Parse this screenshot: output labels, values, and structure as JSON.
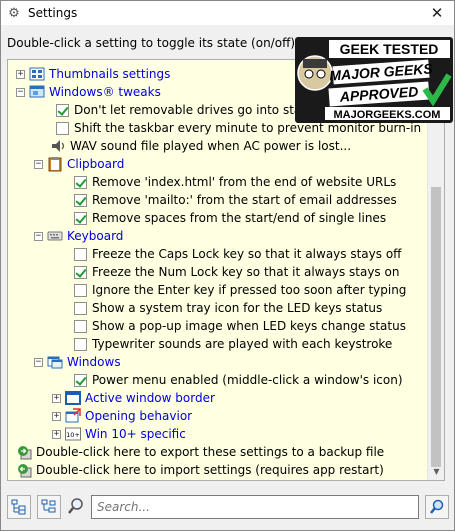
{
  "window": {
    "title": "Settings",
    "close_glyph": "✕"
  },
  "instruction": "Double-click a setting to toggle its state (on/off), or to alter its current value.",
  "tree": {
    "rows": [
      {
        "indent": 8,
        "expander": "+",
        "icon": "thumbnails-icon",
        "label": "Thumbnails settings",
        "blue": true
      },
      {
        "indent": 8,
        "expander": "−",
        "icon": "windows-tweaks-icon",
        "label": "Windows® tweaks",
        "blue": true
      },
      {
        "indent": 48,
        "check": true,
        "checked": true,
        "label": "Don't let removable drives go into standby"
      },
      {
        "indent": 48,
        "check": true,
        "checked": false,
        "label": "Shift the taskbar every minute to prevent monitor burn-in"
      },
      {
        "indent": 42,
        "icon": "speaker-icon",
        "label": "WAV sound file played when AC power is lost..."
      },
      {
        "indent": 26,
        "expander": "−",
        "icon": "clipboard-icon",
        "label": "Clipboard",
        "blue": true
      },
      {
        "indent": 66,
        "check": true,
        "checked": true,
        "label": "Remove 'index.html' from the end of website URLs"
      },
      {
        "indent": 66,
        "check": true,
        "checked": true,
        "label": "Remove 'mailto:' from the start of email addresses"
      },
      {
        "indent": 66,
        "check": true,
        "checked": true,
        "label": "Remove spaces from the start/end of single lines"
      },
      {
        "indent": 26,
        "expander": "−",
        "icon": "keyboard-icon",
        "label": "Keyboard",
        "blue": true
      },
      {
        "indent": 66,
        "check": true,
        "checked": false,
        "label": "Freeze the Caps Lock key so that it always stays off"
      },
      {
        "indent": 66,
        "check": true,
        "checked": true,
        "label": "Freeze the Num Lock key so that it always stays on"
      },
      {
        "indent": 66,
        "check": true,
        "checked": false,
        "label": "Ignore the Enter key if pressed too soon after typing"
      },
      {
        "indent": 66,
        "check": true,
        "checked": false,
        "label": "Show a system tray icon for the LED keys status"
      },
      {
        "indent": 66,
        "check": true,
        "checked": false,
        "label": "Show a pop-up image when LED keys change status"
      },
      {
        "indent": 66,
        "check": true,
        "checked": false,
        "label": "Typewriter sounds are played with each keystroke"
      },
      {
        "indent": 26,
        "expander": "−",
        "icon": "windows-icon",
        "label": "Windows",
        "blue": true
      },
      {
        "indent": 66,
        "check": true,
        "checked": true,
        "label": "Power menu enabled (middle-click a window's icon)"
      },
      {
        "indent": 44,
        "expander": "+",
        "icon": "window-border-icon",
        "label": "Active window border",
        "blue": true
      },
      {
        "indent": 44,
        "expander": "+",
        "icon": "opening-behavior-icon",
        "label": "Opening behavior",
        "blue": true
      },
      {
        "indent": 44,
        "expander": "+",
        "icon": "win10-icon",
        "label": "Win 10+ specific",
        "blue": true
      },
      {
        "indent": 8,
        "icon": "export-icon",
        "label": "Double-click here to export these settings to a backup file"
      },
      {
        "indent": 8,
        "icon": "import-icon",
        "label": "Double-click here to import settings (requires app restart)"
      }
    ]
  },
  "bottom": {
    "search_placeholder": "Search...",
    "expand_all_icon": "expand-tree-icon",
    "collapse_all_icon": "collapse-tree-icon",
    "search_icon": "magnifier-icon",
    "go_icon": "search-go-icon"
  },
  "logo": {
    "line1": "GEEK TESTED",
    "line2": "MAJOR GEEKS",
    "line3": "APPROVED",
    "url": "MAJORGEEKS.COM"
  },
  "colors": {
    "tree_bg": "#ffffe1",
    "link_blue": "#0000e0",
    "check_green": "#1e9e31"
  }
}
